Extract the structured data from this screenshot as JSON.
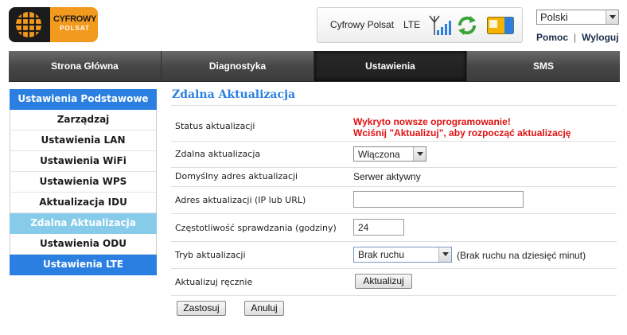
{
  "brand": {
    "logo_line1": "CYFROWY",
    "logo_line2": "POLSAT"
  },
  "status": {
    "operator": "Cyfrowy Polsat",
    "network": "LTE",
    "sim_label": "USIM"
  },
  "language": {
    "selected": "Polski"
  },
  "toplinks": {
    "help": "Pomoc",
    "separator": "|",
    "logout": "Wyloguj"
  },
  "nav": {
    "tabs": [
      "Strona Główna",
      "Diagnostyka",
      "Ustawienia",
      "SMS"
    ],
    "active": "Ustawienia"
  },
  "sidebar": {
    "header": "Ustawienia Podstawowe",
    "items": [
      "Zarządzaj",
      "Ustawienia LAN",
      "Ustawienia WiFi",
      "Ustawienia WPS",
      "Aktualizacja IDU",
      "Zdalna Aktualizacja",
      "Ustawienia ODU",
      "Ustawienia LTE"
    ],
    "active": "Zdalna Aktualizacja"
  },
  "page": {
    "title": "Zdalna Aktualizacja",
    "rows": {
      "status": {
        "label": "Status aktualizacji",
        "line1": "Wykryto nowsze oprogramowanie!",
        "line2": "Wciśnij \"Aktualizuj\", aby rozpocząć aktualizację"
      },
      "remote": {
        "label": "Zdalna aktualizacja",
        "value": "Włączona"
      },
      "default_addr": {
        "label": "Domyślny adres aktualizacji",
        "value": "Serwer aktywny"
      },
      "addr": {
        "label": "Adres aktualizacji (IP lub URL)",
        "value": ""
      },
      "freq": {
        "label": "Częstotliwość sprawdzania (godziny)",
        "value": "24"
      },
      "mode": {
        "label": "Tryb aktualizacji",
        "value": "Brak ruchu",
        "note": "(Brak ruchu na dziesięć minut)"
      },
      "manual": {
        "label": "Aktualizuj ręcznie",
        "button": "Aktualizuj"
      }
    },
    "apply": "Zastosuj",
    "cancel": "Anuluj"
  },
  "colors": {
    "accent": "#2b7fe0",
    "active_side": "#86ccea",
    "warning": "#e01010",
    "brand_orange": "#f29a1d"
  }
}
